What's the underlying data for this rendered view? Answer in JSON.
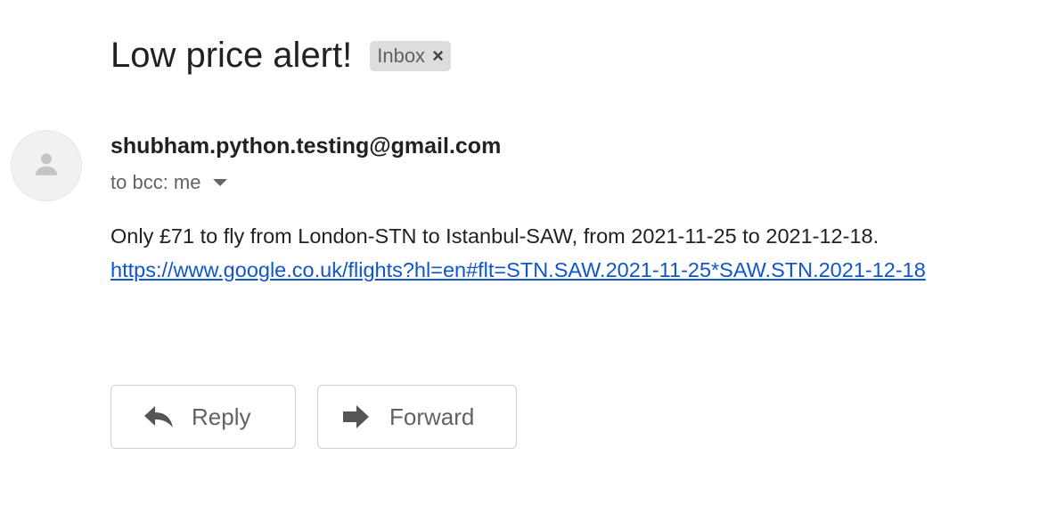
{
  "email": {
    "subject": "Low price alert!",
    "label_chip": {
      "text": "Inbox",
      "remove_glyph": "×"
    },
    "sender": "shubham.python.testing@gmail.com",
    "recipient_line": "to bcc: me",
    "body_line": "Only £71 to fly from London-STN to Istanbul-SAW, from 2021-11-25 to 2021-12-18.",
    "body_link": "https://www.google.co.uk/flights?hl=en#flt=STN.SAW.2021-11-25*SAW.STN.2021-12-18"
  },
  "actions": {
    "reply_label": "Reply",
    "forward_label": "Forward"
  },
  "icons": {
    "avatar": "person-icon",
    "reply": "reply-arrow-icon",
    "forward": "forward-arrow-icon",
    "details": "chevron-down-icon"
  },
  "colors": {
    "link": "#1155cc",
    "chip_background": "#dddddd",
    "secondary_text": "#5f6368"
  }
}
